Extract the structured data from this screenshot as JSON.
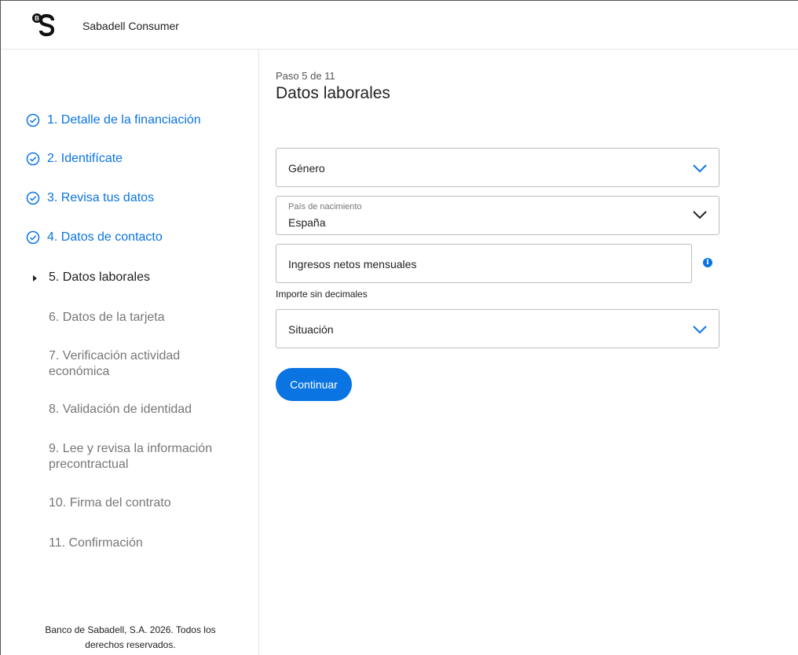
{
  "header": {
    "brand": "Sabadell Consumer",
    "logo_icon": "sabadell-bs-logo"
  },
  "sidebar": {
    "steps": [
      {
        "label": "1. Detalle de la financiación",
        "state": "done"
      },
      {
        "label": "2. Identifícate",
        "state": "done"
      },
      {
        "label": "3. Revisa tus datos",
        "state": "done"
      },
      {
        "label": "4. Datos de contacto",
        "state": "done"
      },
      {
        "label": "5. Datos laborales",
        "state": "current"
      },
      {
        "label": "6. Datos de la tarjeta",
        "state": "todo"
      },
      {
        "label": "7. Verificación actividad económica",
        "state": "todo"
      },
      {
        "label": "8. Validación de identidad",
        "state": "todo"
      },
      {
        "label": "9. Lee y revisa la información precontractual",
        "state": "todo"
      },
      {
        "label": "10. Firma del contrato",
        "state": "todo"
      },
      {
        "label": "11. Confirmación",
        "state": "todo"
      }
    ],
    "footer": "Banco de Sabadell, S.A. 2026. Todos los derechos reservados."
  },
  "main": {
    "step_count": "Paso 5 de 11",
    "title": "Datos laborales",
    "gender": {
      "placeholder": "Género"
    },
    "country": {
      "label": "País de nacimiento",
      "value": "España"
    },
    "income": {
      "placeholder": "Ingresos netos mensuales",
      "hint": "Importe sin decimales"
    },
    "situation": {
      "placeholder": "Situación"
    },
    "continue_label": "Continuar"
  },
  "colors": {
    "accent": "#0a74e3",
    "text": "#222222",
    "muted": "#777777",
    "border": "#bdbdbd"
  }
}
